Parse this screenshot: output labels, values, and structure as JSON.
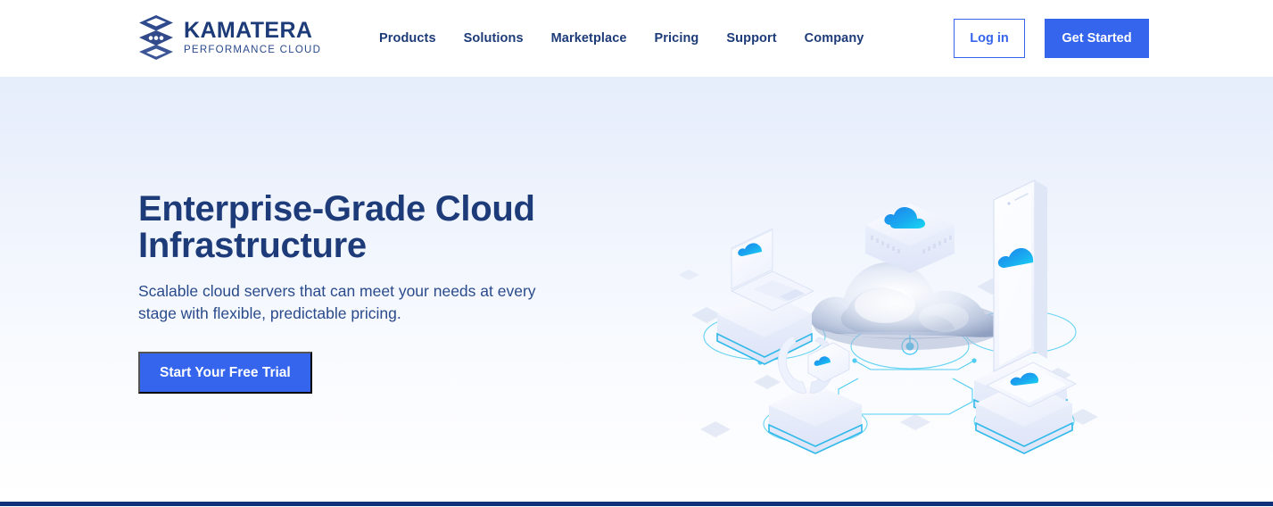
{
  "header": {
    "brand": {
      "name": "KAMATERA",
      "tagline": "PERFORMANCE  CLOUD",
      "logo_icon": "stacked-layers-icon",
      "logo_color": "#2f4b8e"
    },
    "nav": [
      {
        "label": "Products"
      },
      {
        "label": "Solutions"
      },
      {
        "label": "Marketplace"
      },
      {
        "label": "Pricing"
      },
      {
        "label": "Support"
      },
      {
        "label": "Company"
      }
    ],
    "actions": {
      "login_label": "Log in",
      "get_started_label": "Get Started"
    }
  },
  "hero": {
    "title": "Enterprise-Grade Cloud Infrastructure",
    "subtitle": "Scalable cloud servers that can meet your needs at every stage with flexible, predictable pricing.",
    "cta_label": "Start Your Free Trial",
    "illustration": {
      "name": "isometric-cloud-infrastructure-illustration",
      "elements": [
        "central-cloud",
        "server-disc-cloud-icon",
        "laptop-on-pedestal",
        "tablet-on-pedestal",
        "smartwatch-on-pedestal",
        "tablet-flat-on-pedestal",
        "network-connection-lines",
        "floating-diamonds"
      ]
    }
  },
  "colors": {
    "brand_navy": "#1d3b78",
    "accent_blue": "#3465ec",
    "cyan": "#17c4f0",
    "hero_gradient_top": "#e6edfb",
    "hero_gradient_bottom": "#ffffff",
    "bottom_bar": "#0d3279"
  }
}
